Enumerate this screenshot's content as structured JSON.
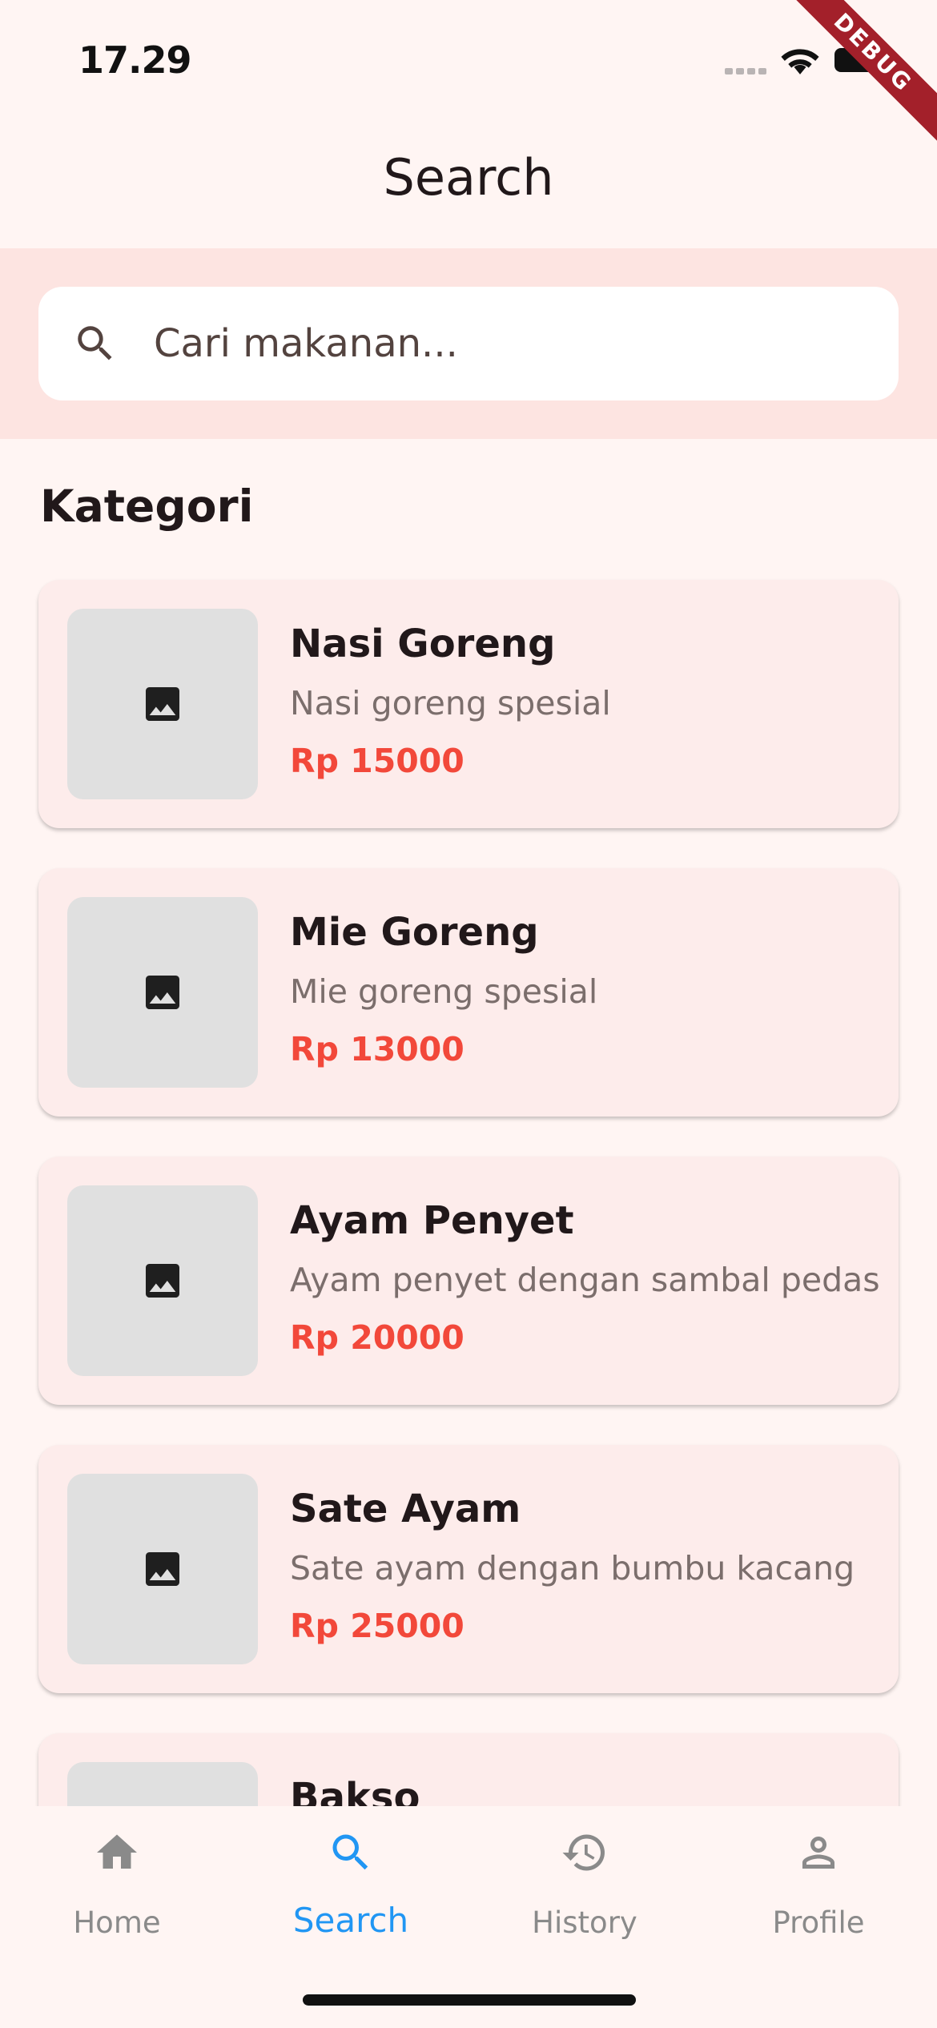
{
  "status_bar": {
    "time": "17.29"
  },
  "debug_banner": "DEBUG",
  "app_bar": {
    "title": "Search"
  },
  "search": {
    "placeholder": "Cari makanan..."
  },
  "section": {
    "title": "Kategori"
  },
  "foods": [
    {
      "name": "Nasi Goreng",
      "description": "Nasi goreng spesial",
      "price": "Rp 15000"
    },
    {
      "name": "Mie Goreng",
      "description": "Mie goreng spesial",
      "price": "Rp 13000"
    },
    {
      "name": "Ayam Penyet",
      "description": "Ayam penyet dengan sambal pedas",
      "price": "Rp 20000"
    },
    {
      "name": "Sate Ayam",
      "description": "Sate ayam dengan bumbu kacang",
      "price": "Rp 25000"
    },
    {
      "name": "Bakso",
      "description": "",
      "price": ""
    }
  ],
  "nav": {
    "items": [
      {
        "label": "Home",
        "icon": "home-icon",
        "active": false
      },
      {
        "label": "Search",
        "icon": "search-icon",
        "active": true
      },
      {
        "label": "History",
        "icon": "history-icon",
        "active": false
      },
      {
        "label": "Profile",
        "icon": "person-icon",
        "active": false
      }
    ],
    "active_color": "#2196f3",
    "inactive_color": "#8a8a8a"
  },
  "colors": {
    "background": "#fff5f3",
    "search_band": "#fde4e1",
    "card": "#fdeceb",
    "price": "#f2483a"
  }
}
